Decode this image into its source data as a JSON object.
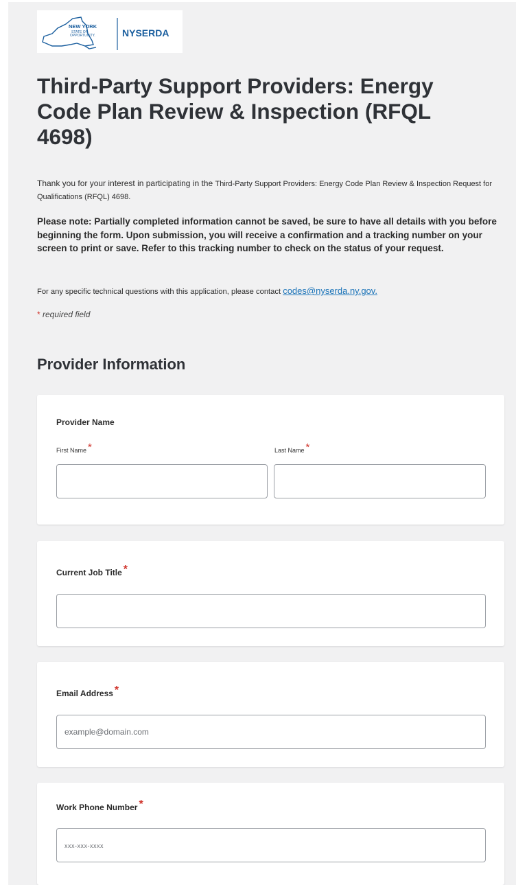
{
  "logo": {
    "state_text_1": "NEW YORK",
    "state_text_2": "STATE OF",
    "state_text_3": "OPPORTUNITY.",
    "brand": "NYSERDA"
  },
  "header": {
    "title": "Third-Party Support Providers: Energy Code Plan Review & Inspection (RFQL 4698)"
  },
  "intro": {
    "text_a": "Thank you for your interest in participating in the ",
    "text_b": "Third-Party Support Providers: Energy Code Plan Review & Inspection Request for Qualifications (RFQL) 4698."
  },
  "note": {
    "text": "Please note: Partially completed information cannot be saved, be sure to have all details with you before beginning the form. Upon submission, you will receive a confirmation and a tracking number on your screen to print or save. Refer to this tracking number to check on the status of your request."
  },
  "contact": {
    "text": "For any specific technical questions with this application, please contact ",
    "email": "codes@nyserda.ny.gov."
  },
  "required_note": {
    "star": "*",
    "text": " required field"
  },
  "section": {
    "title": "Provider Information"
  },
  "form": {
    "provider_name": {
      "label": "Provider Name",
      "first_name_label": "First Name",
      "last_name_label": "Last Name",
      "first_name_value": "",
      "last_name_value": ""
    },
    "job_title": {
      "label": "Current Job Title",
      "value": ""
    },
    "email": {
      "label": "Email Address",
      "value": "",
      "placeholder": "example@domain.com"
    },
    "phone": {
      "label": "Work Phone Number",
      "value": "",
      "placeholder": "xxx-xxx-xxxx"
    },
    "required_star": "*"
  },
  "colors": {
    "page_bg": "#f1f1f2",
    "card_bg": "#ffffff",
    "required_star": "#d0342c",
    "link": "#1a73b8",
    "brand_blue": "#1a5e9e"
  }
}
